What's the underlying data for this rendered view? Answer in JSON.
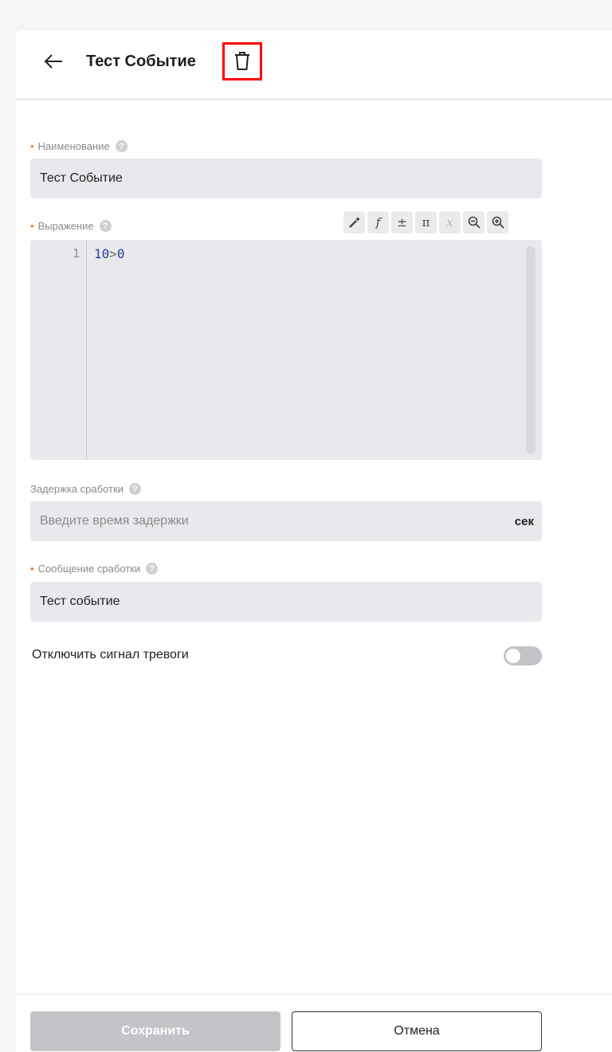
{
  "header": {
    "back_icon": "arrow-left-icon",
    "title": "Тест Событие",
    "delete_icon": "trash-icon"
  },
  "fields": {
    "name": {
      "label": "Наименование",
      "required": true,
      "value": "Тест Событие"
    },
    "expression": {
      "label": "Выражение",
      "required": true,
      "line_number": "1",
      "code_number_a": "10",
      "code_op": ">",
      "code_number_b": "0",
      "toolbar": [
        {
          "name": "magic-wand-icon",
          "glyph": "✨"
        },
        {
          "name": "function-icon",
          "glyph": "f"
        },
        {
          "name": "plus-minus-icon",
          "glyph": "±"
        },
        {
          "name": "pi-icon",
          "glyph": "π"
        },
        {
          "name": "variable-icon",
          "glyph": "x"
        },
        {
          "name": "zoom-out-icon",
          "glyph": "−"
        },
        {
          "name": "zoom-in-icon",
          "glyph": "+"
        }
      ]
    },
    "delay": {
      "label": "Задержка сработки",
      "required": false,
      "placeholder": "Введите время задержки",
      "unit": "сек"
    },
    "message": {
      "label": "Сообщение сработки",
      "required": true,
      "value": "Тест событие"
    }
  },
  "alarm_toggle": {
    "label": "Отключить сигнал тревоги",
    "enabled": false
  },
  "footer": {
    "save_label": "Сохранить",
    "cancel_label": "Отмена"
  },
  "colors": {
    "required_marker": "#f07a2a",
    "highlight_border": "#ff0000",
    "field_bg": "#e9e9ed",
    "disabled_button": "#c4c4c8"
  }
}
